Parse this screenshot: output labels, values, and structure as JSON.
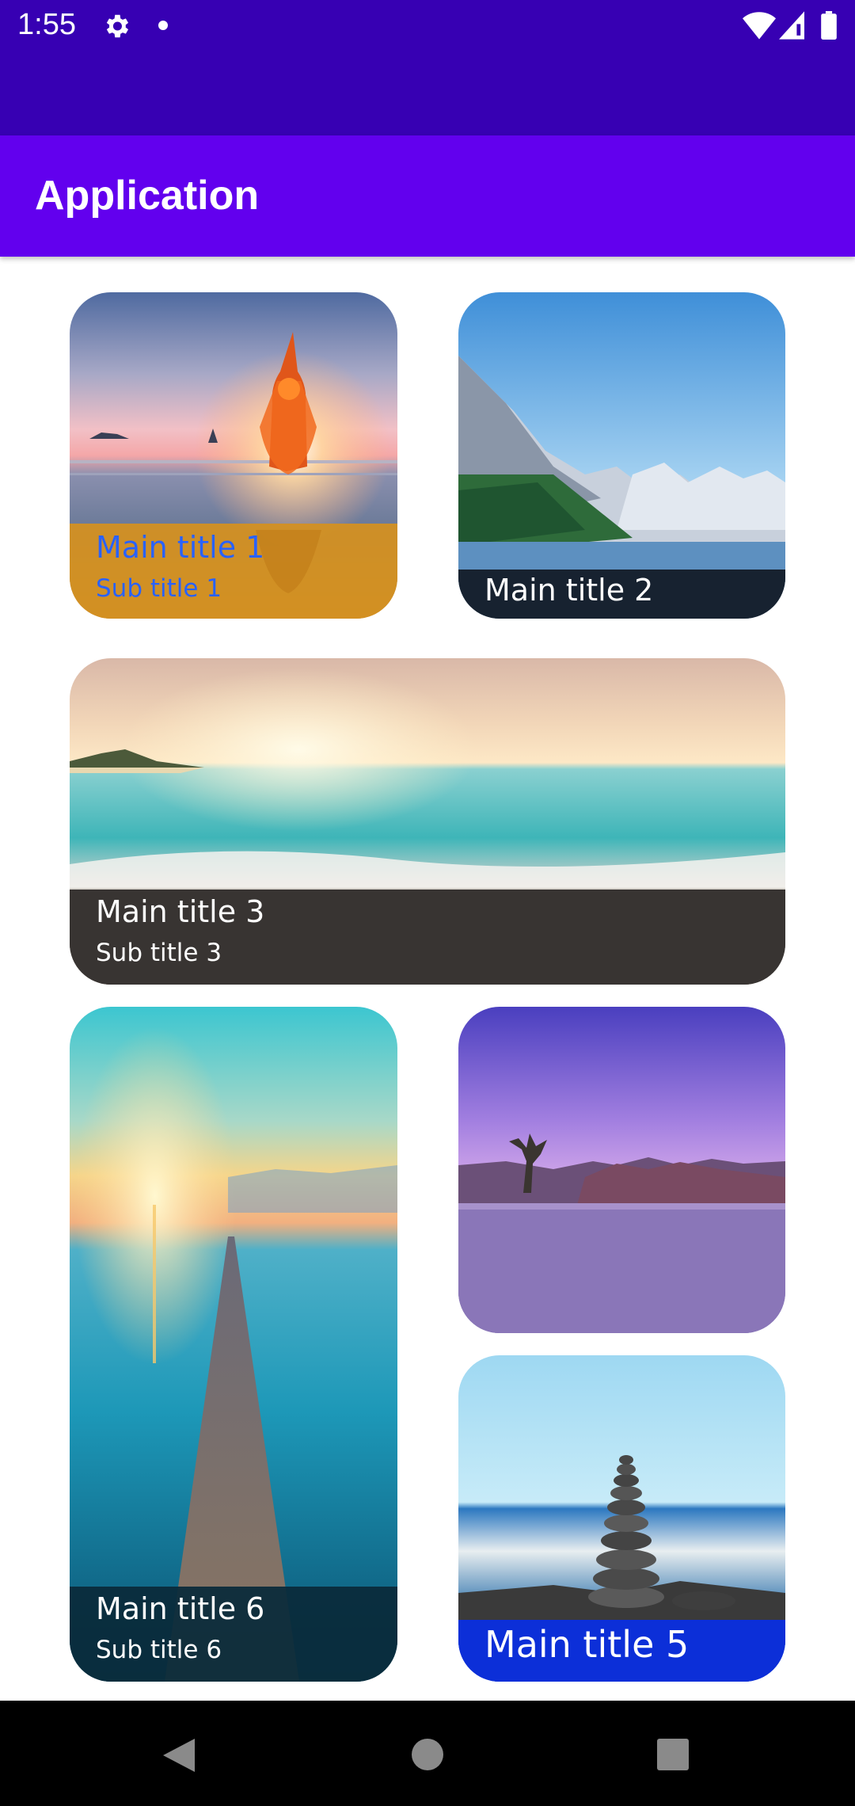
{
  "status_bar": {
    "time": "1:55",
    "icons": [
      "gear-icon",
      "notification-dot-icon",
      "wifi-icon",
      "cell-signal-icon",
      "battery-icon"
    ]
  },
  "app_bar": {
    "title": "Application",
    "color": "#6200ee",
    "status_color": "#3700b3"
  },
  "cards": [
    {
      "main": "Main title 1",
      "sub": "Sub title 1",
      "caption_color": "#2962ff",
      "image": "yoga-sunset-beach"
    },
    {
      "main": "Main title 2",
      "image": "mountain-lake"
    },
    {
      "main": "Main title 3",
      "sub": "Sub title 3",
      "image": "tropical-beach-sunset"
    },
    {
      "image": "lone-tree-lake"
    },
    {
      "main": "Main title 5",
      "image": "stone-stack-sea"
    },
    {
      "main": "Main title 6",
      "sub": "Sub title 6",
      "image": "wooden-pier-sunset"
    }
  ],
  "nav_bar": {
    "icons": [
      "back-icon",
      "home-icon",
      "recents-icon"
    ]
  }
}
